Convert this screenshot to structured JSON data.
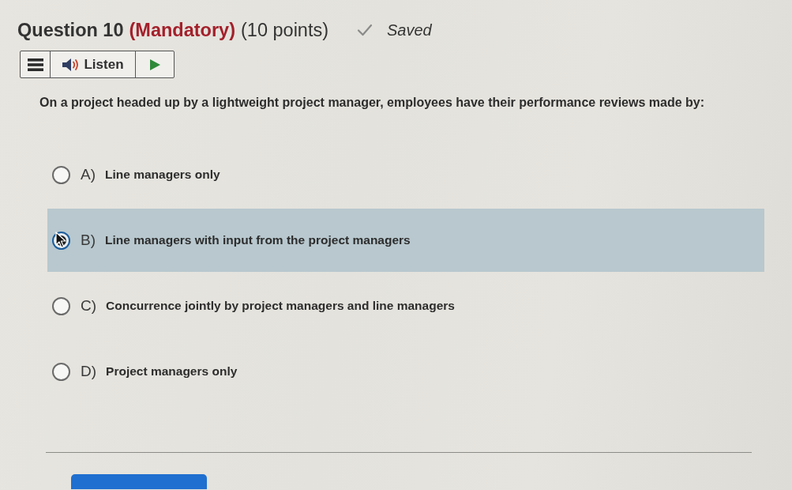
{
  "question": {
    "label": "Question 10",
    "requirement": "(Mandatory)",
    "points": "(10 points)",
    "save_status": "Saved"
  },
  "toolbar": {
    "listen_label": "Listen"
  },
  "prompt": "On a project headed up by a lightweight project manager, employees have their performance reviews made by:",
  "options": [
    {
      "letter": "A)",
      "text": "Line managers only",
      "selected": false
    },
    {
      "letter": "B)",
      "text": "Line managers with input from the project managers",
      "selected": true
    },
    {
      "letter": "C)",
      "text": "Concurrence jointly by project managers and line managers",
      "selected": false
    },
    {
      "letter": "D)",
      "text": "Project managers only",
      "selected": false
    }
  ]
}
